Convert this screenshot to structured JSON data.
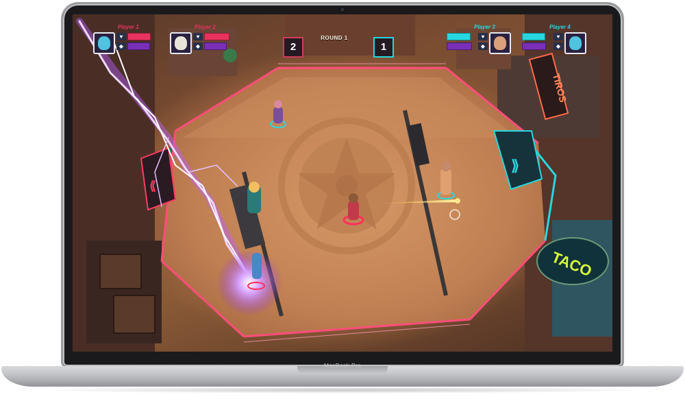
{
  "device": {
    "brand_label": "MacBook Pro"
  },
  "game": {
    "round_label": "ROUND 1",
    "score_left": "2",
    "score_right": "1",
    "players": [
      {
        "name": "Player 1",
        "team_color": "#e8335f",
        "health": 0.55,
        "energy": 0.5
      },
      {
        "name": "Player 2",
        "team_color": "#e8335f",
        "health": 0.7,
        "energy": 0.5
      },
      {
        "name": "Player 3",
        "team_color": "#27d7e0",
        "health": 0.6,
        "energy": 0.7
      },
      {
        "name": "Player 4",
        "team_color": "#27d7e0",
        "health": 0.55,
        "energy": 0.6
      }
    ],
    "hud_icons": [
      "heart-icon",
      "shield-icon"
    ],
    "signs": {
      "taco": "TACO",
      "tiros": "TIROS"
    }
  }
}
